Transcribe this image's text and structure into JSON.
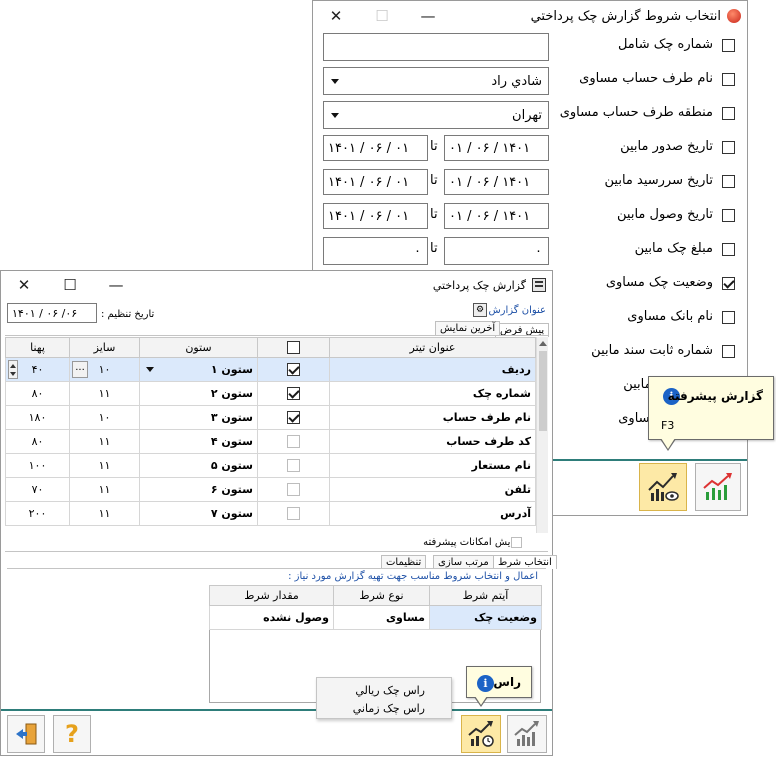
{
  "filter_window": {
    "title": "انتخاب شروط گزارش چک پرداختي",
    "conditions": [
      {
        "label": "شماره چک شامل",
        "checked": false
      },
      {
        "label": "نام طرف حساب مساوی",
        "checked": false
      },
      {
        "label": "منطقه طرف حساب مساوی",
        "checked": false
      },
      {
        "label": "تاریخ صدور مابین",
        "checked": false
      },
      {
        "label": "تاریخ سررسید مابین",
        "checked": false
      },
      {
        "label": "تاریخ وصول مابین",
        "checked": false
      },
      {
        "label": "مبلغ چک مابین",
        "checked": false
      },
      {
        "label": "وضعیت چک مساوی",
        "checked": true
      },
      {
        "label": "نام بانک مساوی",
        "checked": false
      },
      {
        "label": "شماره ثابت سند  مابین",
        "checked": false
      },
      {
        "label": "وصول چک مابین",
        "checked": false
      },
      {
        "label": "دی/ابطال مساوی",
        "checked": false
      }
    ],
    "check_number_value": "",
    "account_name_value": "شادي راد",
    "region_value": "تهران",
    "between_label": "تا",
    "issue_date_from": "۰۱ / ۰۶ / ۱۴۰۱",
    "issue_date_to": "۱۴۰۱ / ۰۶ / ۰۱",
    "due_date_from": "۰۱ / ۰۶ / ۱۴۰۱",
    "due_date_to": "۱۴۰۱ / ۰۶ / ۰۱",
    "collect_date_from": "۰۱ / ۰۶ / ۱۴۰۱",
    "collect_date_to": "۱۴۰۱ / ۰۶ / ۰۱",
    "amount_from": "۰",
    "amount_to": "۰"
  },
  "advanced_tip": {
    "title": "گزارش پیشرفته",
    "shortcut": "F3"
  },
  "report_window": {
    "title": "گزارش چک پرداختي",
    "report_title_label": "عنوان گزارش :",
    "set_date_label": "تاریخ تنظیم :",
    "set_date_value": "۱۴۰۱ / ۰۶ /۰۶",
    "tabs": [
      "پیش فرض",
      "آخرین نمایش"
    ],
    "columns": {
      "title": "عنوان تیتر",
      "column": "ستون",
      "size": "سایز",
      "width": "پهنا"
    },
    "rows": [
      {
        "title": "ردیف",
        "checked": true,
        "column": "ستون ۱",
        "size": "۱۰",
        "width": "۴۰",
        "selected": true
      },
      {
        "title": "شماره چک",
        "checked": true,
        "column": "ستون ۲",
        "size": "۱۱",
        "width": "۸۰",
        "selected": false
      },
      {
        "title": "نام طرف حساب",
        "checked": true,
        "column": "ستون ۳",
        "size": "۱۰",
        "width": "۱۸۰",
        "selected": false
      },
      {
        "title": "کد طرف حساب",
        "checked": false,
        "column": "ستون ۴",
        "size": "۱۱",
        "width": "۸۰",
        "selected": false
      },
      {
        "title": "نام مستعار",
        "checked": false,
        "column": "ستون ۵",
        "size": "۱۱",
        "width": "۱۰۰",
        "selected": false
      },
      {
        "title": "تلفن",
        "checked": false,
        "column": "ستون ۶",
        "size": "۱۱",
        "width": "۷۰",
        "selected": false
      },
      {
        "title": "آدرس",
        "checked": false,
        "column": "ستون ۷",
        "size": "۱۱",
        "width": "۲۰۰",
        "selected": false
      }
    ],
    "size_button": "...",
    "show_advanced_label": "نمایش امکانات پیشرفته",
    "bottom_tabs": [
      "انتخاب شرط",
      "مرتب سازی",
      "تنظیمات"
    ],
    "hint": "اعمال و انتخاب شروط مناسب جهت تهیه گزارش  مورد نیاز :",
    "cond_columns": {
      "item": "آیتم شرط",
      "type": "نوع شرط",
      "value": "مقدار شرط"
    },
    "cond_rows": [
      {
        "item": "وضعیت چک",
        "type": "مساوی",
        "value": "وصول نشده"
      }
    ]
  },
  "ras_tip": {
    "title": "راس"
  },
  "ras_menu": {
    "items": [
      "راس چک ريالي",
      "راس چک زماني"
    ]
  },
  "colors": {
    "accent_blue": "#1c63c6",
    "highlight": "#fde9a6",
    "selected_row": "#dbe9fb",
    "tooltip": "#fffde0"
  }
}
